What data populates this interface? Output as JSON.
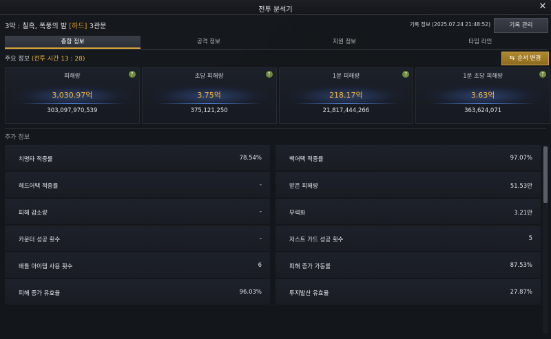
{
  "window": {
    "title": "전투 분석기",
    "close_icon": "close-icon"
  },
  "header": {
    "stage_prefix": "3막 : 칠흑, 폭풍의 밤 ",
    "difficulty": "[하드]",
    "stage_suffix": " 3관문",
    "record_info": "기록 정보 (2025.07.24 21:48:52)",
    "record_button": "기록 관리"
  },
  "tabs": [
    {
      "label": "종합 정보",
      "active": true
    },
    {
      "label": "공격 정보",
      "active": false
    },
    {
      "label": "지원 정보",
      "active": false
    },
    {
      "label": "타임 라인",
      "active": false
    }
  ],
  "main_info": {
    "label": "주요 정보 ",
    "battle_time": "(전투 시간 13 : 28)",
    "order_button": "순서 변경"
  },
  "cards": [
    {
      "label": "피해량",
      "value": "3,030.97억",
      "raw": "303,097,970,539"
    },
    {
      "label": "초당 피해량",
      "value": "3.75억",
      "raw": "375,121,250"
    },
    {
      "label": "1분 피해량",
      "value": "218.17억",
      "raw": "21,817,444,266"
    },
    {
      "label": "1분 초당 피해량",
      "value": "3.63억",
      "raw": "363,624,071"
    }
  ],
  "extra": {
    "title": "추가 정보",
    "rows": [
      {
        "name": "치명타 적중률",
        "value": "78.54%"
      },
      {
        "name": "백어택 적중률",
        "value": "97.07%"
      },
      {
        "name": "헤드어택 적중률",
        "value": "-"
      },
      {
        "name": "받은 피해량",
        "value": "51.53만"
      },
      {
        "name": "피해 감소량",
        "value": "-"
      },
      {
        "name": "무력화",
        "value": "3.21만"
      },
      {
        "name": "카운터 성공 횟수",
        "value": "-"
      },
      {
        "name": "저스트 가드 성공 횟수",
        "value": "5"
      },
      {
        "name": "배틀 아이템 사용 횟수",
        "value": "6"
      },
      {
        "name": "피해 증가 가동률",
        "value": "87.53%"
      },
      {
        "name": "피해 증가 유효율",
        "value": "96.03%"
      },
      {
        "name": "투지발산 유효율",
        "value": "27.87%"
      }
    ]
  },
  "help_glyph": "?",
  "close_glyph": "✕",
  "swap_glyph": "⇆"
}
